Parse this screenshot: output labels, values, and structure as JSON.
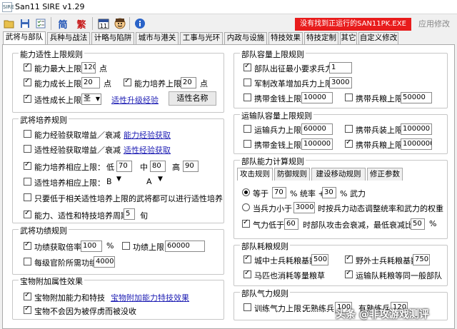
{
  "window": {
    "title": "San11 SIRE v1.29",
    "icon_text": "SIRE"
  },
  "toolbar": {
    "icons": [
      "open-icon",
      "save-icon",
      "checklist-icon",
      "simplified-icon",
      "traditional-icon",
      "calendar-icon",
      "face-icon",
      "info-icon"
    ],
    "simplified_label": "简",
    "traditional_label": "繁",
    "calendar_label": "11"
  },
  "status": {
    "message": "没有找到正运行的SAN11PK.EXE",
    "color": "#e81c1c"
  },
  "apply_button": "应用修改",
  "tabs": [
    "武将与部队",
    "兵种与战法",
    "计略与陷阱",
    "城市与港关",
    "工事与光环",
    "内政与设施",
    "特技效果",
    "特技定制",
    "其它",
    "自定义修改"
  ],
  "ability_limits": {
    "legend": "能力适性上限规则",
    "max_ability_label": "能力最大上限",
    "max_ability_value": "120",
    "max_ability_unit": "点",
    "growth_limit_label": "能力成长上限",
    "growth_limit_value": "20",
    "growth_limit_unit": "点",
    "train_limit_label": "能力培养上限",
    "train_limit_value": "20",
    "train_limit_unit": "点",
    "apt_growth_label": "适性成长上限",
    "apt_growth_value": "圣",
    "apt_exp_link": "适性升级经验",
    "apt_name_button": "适性名称"
  },
  "training": {
    "legend": "武将培养规则",
    "ability_exp_label": "能力经验获取增益／衰减",
    "ability_exp_link": "能力经验获取",
    "apt_exp_label": "适性经验获取增益／衰减",
    "apt_exp_link": "适性经验获取",
    "ability_train_label": "能力培养相应上限：",
    "low_label": "低",
    "low_value": "70",
    "mid_label": "中",
    "mid_value": "80",
    "high_label": "高",
    "high_value": "90",
    "apt_train_label": "适性培养相应上限：",
    "b_label": "B",
    "a_label": "A",
    "only_below_label": "只要低于相关适性培养上限的武将都可以进行适性培养",
    "cycle_label": "能力、适性和特技培养周期",
    "cycle_value": "5",
    "cycle_unit": "旬"
  },
  "merit": {
    "legend": "武将功绩规则",
    "rate_label": "功绩获取倍率",
    "rate_value": "100",
    "rate_unit": "%",
    "limit_label": "功绩上限",
    "limit_value": "60000",
    "rank_label": "每级官阶所需功绩",
    "rank_value": "4000"
  },
  "treasure": {
    "legend": "宝物附加属性效果",
    "extra_label": "宝物附加能力和特技",
    "extra_link": "宝物附加能力特技效果",
    "no_confiscate_label": "宝物不会因为被俘虏而被没收"
  },
  "unit_capacity": {
    "legend": "部队容量上限规则",
    "min_troops_label": "部队出征最小要求兵力",
    "min_troops_value": "1",
    "military_label": "军制改革增加兵力上限",
    "military_value": "3000",
    "gold_label": "携带金钱上限",
    "gold_value": "10000",
    "food_label": "携带兵粮上限",
    "food_value": "50000"
  },
  "transport_capacity": {
    "legend": "运输队容量上限规则",
    "troops_label": "运输兵力上限",
    "troops_value": "60000",
    "weapons_label": "携带兵装上限",
    "weapons_value": "100000",
    "gold_label": "携带金钱上限",
    "gold_value": "100000",
    "food_label": "携带兵粮上限",
    "food_value": "1000000"
  },
  "unit_ability": {
    "legend": "部队能力计算规则",
    "subtabs": [
      "攻击规则",
      "防御规则",
      "建设移动规则",
      "修正参数"
    ],
    "equal_label": "等于",
    "equal_value": "70",
    "command_label": "% 统率 +",
    "force_value": "30",
    "force_label": "% 武力",
    "below_label": "当兵力小于",
    "below_value": "3000",
    "below_desc": "时按兵力动态调整统率和武力的权重",
    "morale_label": "气力低于",
    "morale_value": "60",
    "morale_desc": "时部队攻击会衰减，最低衰减比例",
    "min_ratio_value": "50",
    "min_ratio_unit": "%"
  },
  "food_consumption": {
    "legend": "部队耗粮规则",
    "city_label": "城中士兵耗粮基数",
    "city_value": "500",
    "field_label": "野外士兵耗粮基数",
    "field_value": "750",
    "horse_label": "马匹也消耗等量粮草",
    "transport_label": "运输队耗粮等同一般部队"
  },
  "morale": {
    "legend": "部队气力规则",
    "training_label": "训练气力上限：",
    "unskilled_label": "无熟练兵",
    "unskilled_value": "100",
    "skilled_label": "有熟练兵",
    "skilled_value": "120"
  },
  "watermark": "头条 @非攻游戏测评"
}
